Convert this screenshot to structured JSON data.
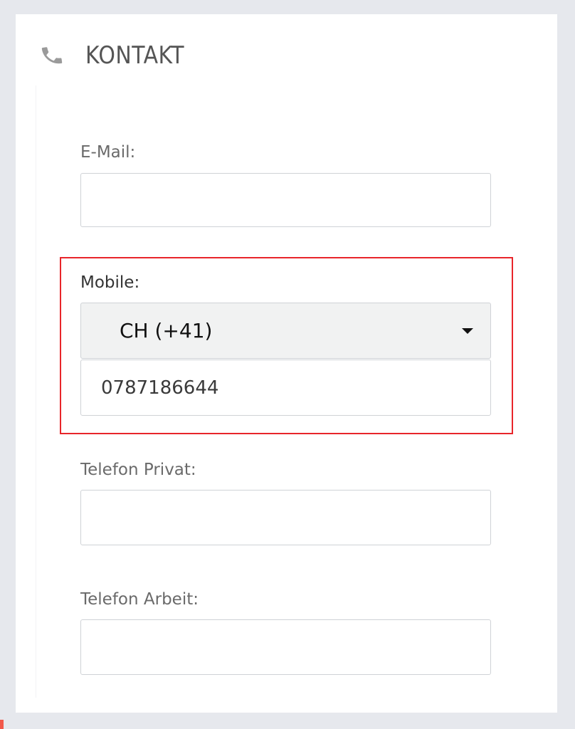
{
  "header": {
    "title": "KONTAKT",
    "icon": "phone-icon"
  },
  "email": {
    "label": "E-Mail:",
    "value": ""
  },
  "mobile": {
    "label": "Mobile:",
    "country_code": "CH (+41)",
    "value": "0787186644"
  },
  "telefon_privat": {
    "label": "Telefon Privat:",
    "value": ""
  },
  "telefon_arbeit": {
    "label": "Telefon Arbeit:",
    "value": ""
  },
  "colors": {
    "highlight": "#e8252a",
    "background": "#e6e8ed",
    "select_bg": "#f1f2f2",
    "label_text": "#6a6a6a"
  }
}
